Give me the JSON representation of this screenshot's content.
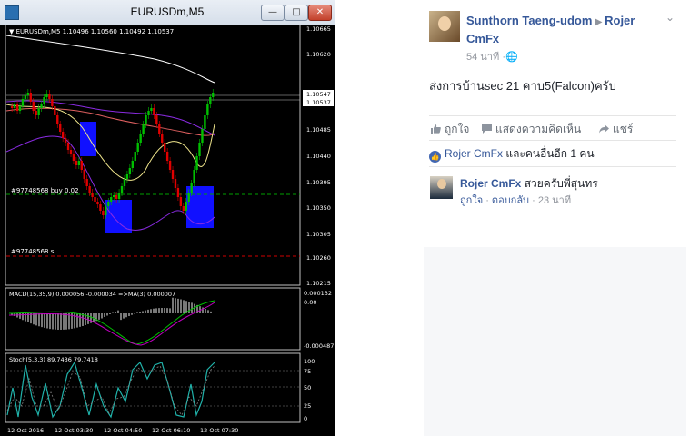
{
  "mt4": {
    "window_title": "EURUSDm,M5",
    "buttons": {
      "minimize": "—",
      "maximize": "□",
      "close": "✕"
    },
    "header_text": "▼ EURUSDm,M5  1.10496 1.10560 1.10492 1.10537",
    "price_labels": [
      "1.10665",
      "1.10620",
      "1.10547",
      "1.10537",
      "1.10485",
      "1.10440",
      "1.10395",
      "1.10350",
      "1.10305",
      "1.10260",
      "1.10215"
    ],
    "order_labels": [
      "#97748568 buy 0.02",
      "#97748568 sl"
    ],
    "macd_label": "MACD(15,35,9) 0.000056 -0.000034 =>MA(3) 0.000007",
    "macd_scale": [
      "0.000132",
      "0.00",
      "-0.000487"
    ],
    "stoch_label": "Stoch(5,3,3) 89.7436 79.7418",
    "stoch_scale": [
      "100",
      "75",
      "50",
      "25",
      "0"
    ],
    "time_labels": [
      "12 Oct 2016",
      "12 Oct 03:30",
      "12 Oct 04:50",
      "12 Oct 06:10",
      "12 Oct 07:30"
    ],
    "colors": {
      "bull": "#00c000",
      "bear": "#e00000",
      "buy_line": "#00a000",
      "sl_line": "#d00000",
      "zone": "#1010ff",
      "envelope": "#8a2be2",
      "ma_white": "#ffffff"
    }
  },
  "facebook": {
    "author": "Sunthorn Taeng-udom",
    "target": "Rojer CmFx",
    "time": "54 นาที",
    "privacy_icon": "globe-icon",
    "post_text": "ส่งการบ้านsec 21 คาบ5(Falcon)ครับ",
    "actions": {
      "like": "ถูกใจ",
      "comment": "แสดงความคิดเห็น",
      "share": "แชร์"
    },
    "likes_text_name": "Rojer CmFx",
    "likes_text_rest": "และคนอื่นอีก 1 คน",
    "comment": {
      "name": "Rojer CmFx",
      "text": "สวยครับพี่สุนทร",
      "like": "ถูกใจ",
      "reply": "ตอบกลับ",
      "time": "23 นาที"
    }
  }
}
